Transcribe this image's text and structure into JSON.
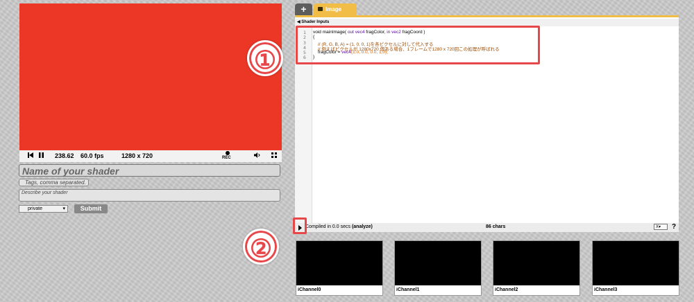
{
  "preview": {
    "time": "238.62",
    "fps": "60.0 fps",
    "resolution": "1280 x 720",
    "rec_label": "REC",
    "color": "#ec3727"
  },
  "form": {
    "name_placeholder": "Name of your shader",
    "tags_placeholder": "Tags, comma separated.",
    "description_placeholder": "Describe your shader",
    "privacy_value": "private",
    "submit_label": "Submit"
  },
  "tabs": {
    "add_label": "+",
    "image_label": "Image"
  },
  "shader_inputs_label": "◀ Shader Inputs",
  "editor": {
    "line_numbers": [
      "1",
      "2",
      "3",
      "4",
      "5",
      "6"
    ],
    "code_line1_a": "void mainImage(",
    "code_line1_b": " out vec4",
    "code_line1_c": " fragColor,",
    "code_line1_d": " in vec2",
    "code_line1_e": " fragCoord )",
    "code_line2": "{",
    "code_line3": "// (R, G, B, A) = (1, 0, 0, 1)を各ピクセルに対して代入する",
    "code_line4": "// 例えばピクセルが 1280x720 個ある場合、1フレームで1280 x 720回この処理が呼ばれる",
    "code_line5_a": "fragColor = ",
    "code_line5_b": "vec4",
    "code_line5_c": "(1.0, 0.0, 0.0, 1.0);",
    "code_line6": "}"
  },
  "status": {
    "compiled_text": "Compiled in 0.0 secs",
    "analyze_label": "(analyze)",
    "char_count": "86 chars",
    "x_select": "X▾",
    "help": "?"
  },
  "channels": [
    "iChannel0",
    "iChannel1",
    "iChannel2",
    "iChannel3"
  ],
  "annotations": {
    "badge1": "①",
    "badge2": "②",
    "accent": "#e8474a"
  }
}
